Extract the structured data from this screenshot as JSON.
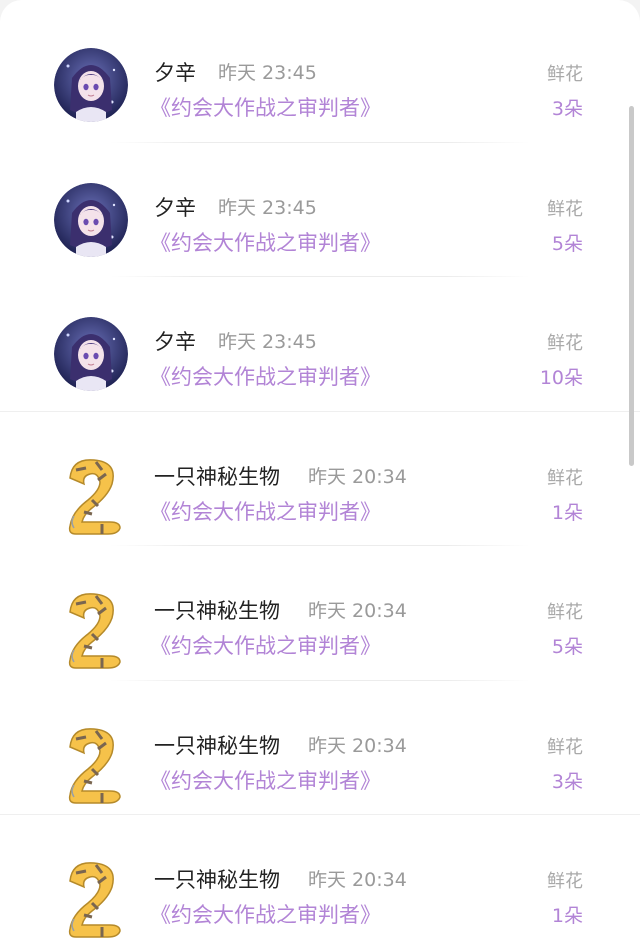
{
  "rows": [
    {
      "user": "夕辛",
      "time": "昨天 23:45",
      "work": "《约会大作战之审判者》",
      "gift": "鲜花",
      "count": "3朵",
      "avatar": "anime-girl"
    },
    {
      "user": "夕辛",
      "time": "昨天 23:45",
      "work": "《约会大作战之审判者》",
      "gift": "鲜花",
      "count": "5朵",
      "avatar": "anime-girl"
    },
    {
      "user": "夕辛",
      "time": "昨天 23:45",
      "work": "《约会大作战之审判者》",
      "gift": "鲜花",
      "count": "10朵",
      "avatar": "anime-girl"
    },
    {
      "user": "一只神秘生物",
      "time": "昨天 20:34",
      "work": "《约会大作战之审判者》",
      "gift": "鲜花",
      "count": "1朵",
      "avatar": "mystery-creature"
    },
    {
      "user": "一只神秘生物",
      "time": "昨天 20:34",
      "work": "《约会大作战之审判者》",
      "gift": "鲜花",
      "count": "5朵",
      "avatar": "mystery-creature"
    },
    {
      "user": "一只神秘生物",
      "time": "昨天 20:34",
      "work": "《约会大作战之审判者》",
      "gift": "鲜花",
      "count": "3朵",
      "avatar": "mystery-creature"
    },
    {
      "user": "一只神秘生物",
      "time": "昨天 20:34",
      "work": "《约会大作战之审判者》",
      "gift": "鲜花",
      "count": "1朵",
      "avatar": "mystery-creature"
    }
  ],
  "colors": {
    "accent": "#b284d6",
    "muted": "#9a9a9a",
    "text": "#222222"
  }
}
